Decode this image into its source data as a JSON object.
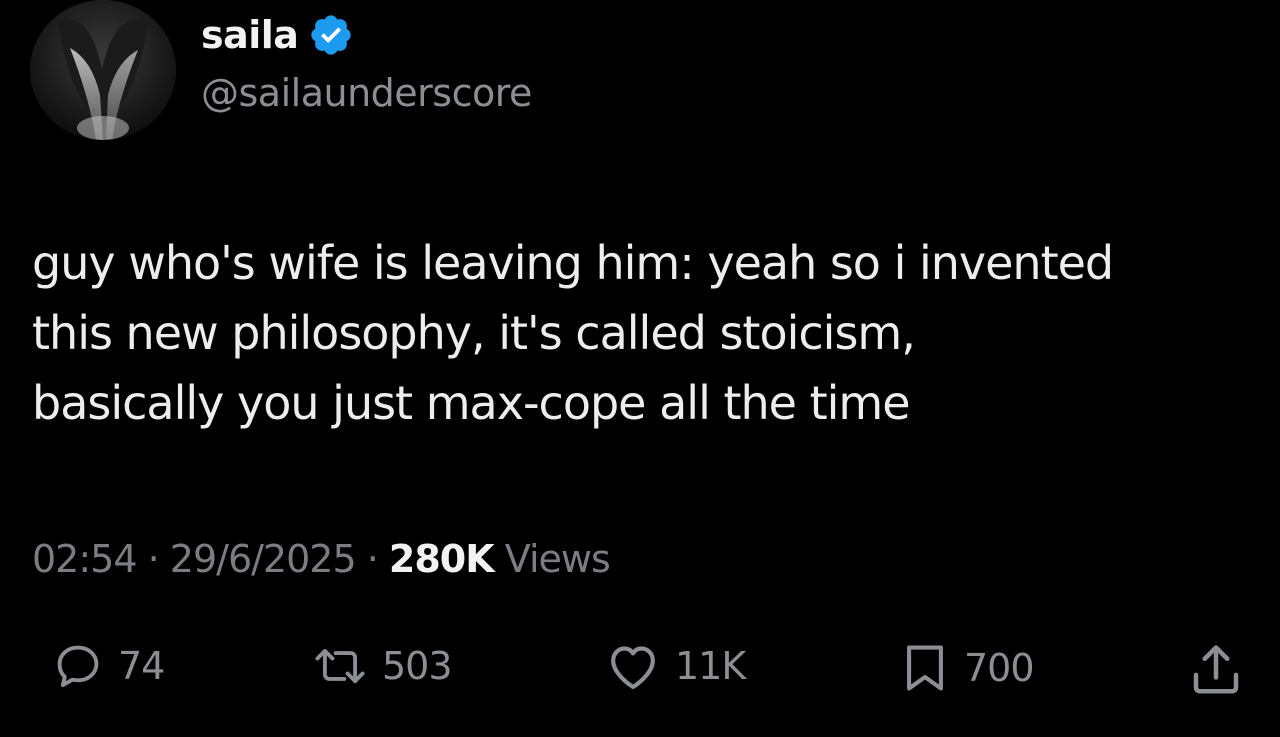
{
  "author": {
    "display_name": "saila",
    "handle": "@sailaunderscore",
    "verified": true,
    "verified_color": "#1d9bf0",
    "avatar_icon": "avatar-photo"
  },
  "tweet": {
    "lines": [
      "guy who's wife is leaving him: yeah so i invented",
      "this new philosophy, it's called stoicism,",
      "basically you just max-cope all the time"
    ]
  },
  "meta": {
    "time": "02:54",
    "separator": "·",
    "date": "29/6/2025",
    "views_count": "280K",
    "views_label": "Views"
  },
  "actions": {
    "replies": "74",
    "reposts": "503",
    "likes": "11K",
    "bookmarks": "700"
  },
  "colors": {
    "background": "#000000",
    "text": "#e7e9ea",
    "muted": "#8b8f94"
  }
}
